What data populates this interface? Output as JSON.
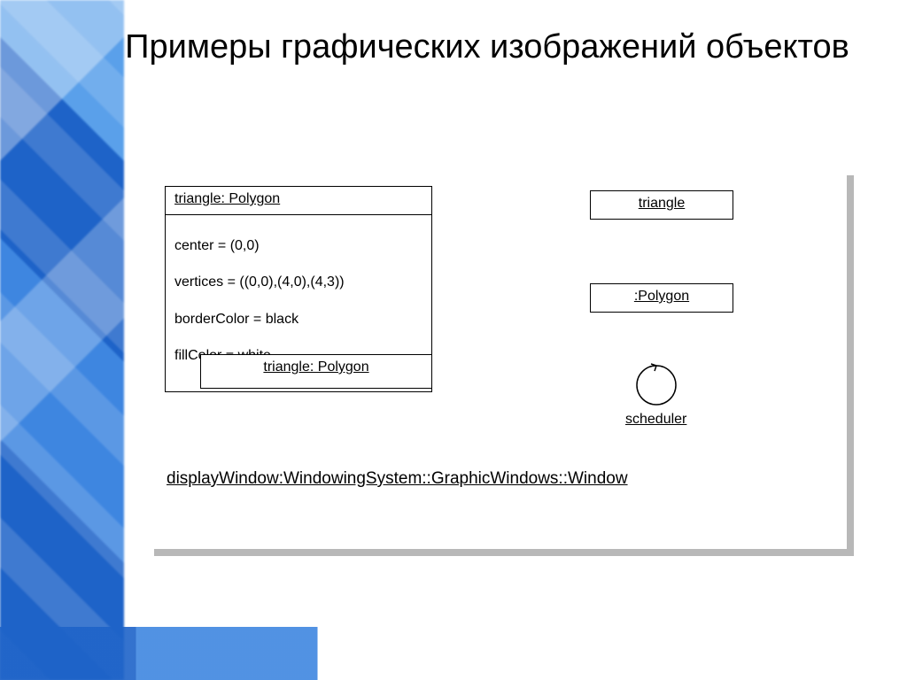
{
  "title": "Примеры графических изображений объектов",
  "box1": {
    "header": "triangle: Polygon",
    "attrs": [
      "center = (0,0)",
      "vertices = ((0,0),(4,0),(4,3))",
      "borderColor = black",
      "fillColor = white"
    ]
  },
  "box2": {
    "header": "triangle"
  },
  "box3": {
    "header": ":Polygon"
  },
  "box4": {
    "header": "triangle: Polygon"
  },
  "active": {
    "label": "scheduler"
  },
  "longname": "displayWindow:WindowingSystem::GraphicWindows::Window"
}
